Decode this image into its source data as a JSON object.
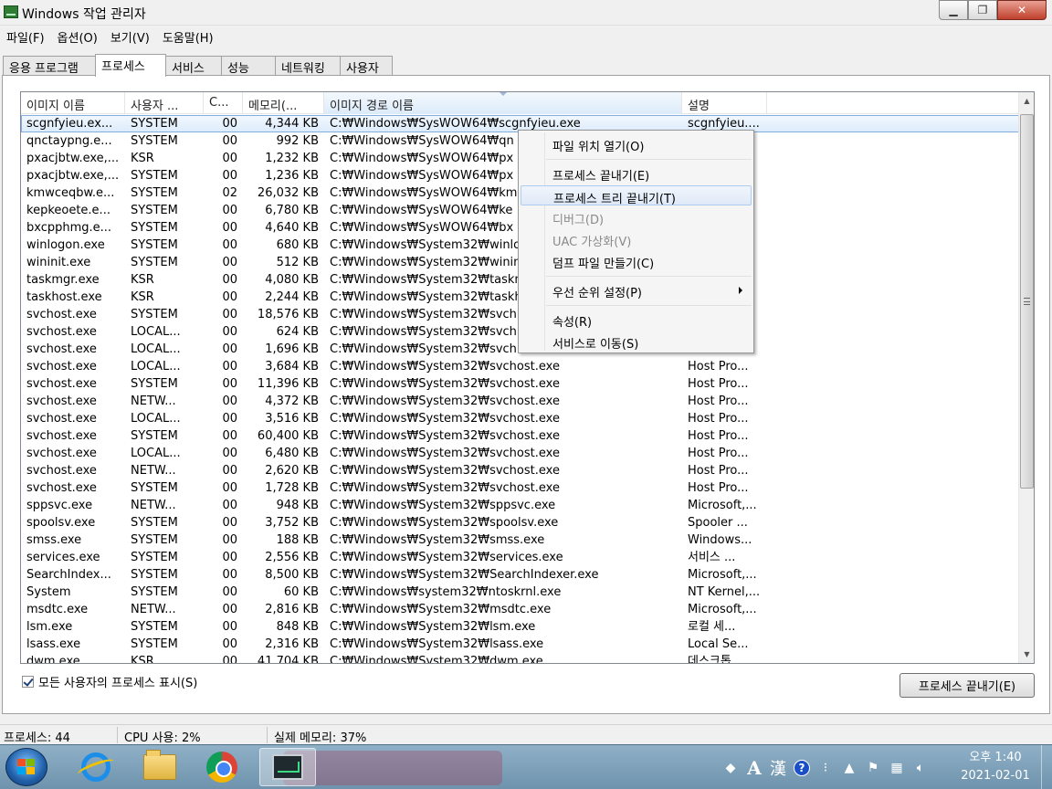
{
  "window": {
    "title": "Windows 작업 관리자"
  },
  "menu": [
    "파일(F)",
    "옵션(O)",
    "보기(V)",
    "도움말(H)"
  ],
  "tabs": [
    {
      "label": "응용 프로그램",
      "active": false
    },
    {
      "label": "프로세스",
      "active": true
    },
    {
      "label": "서비스",
      "active": false
    },
    {
      "label": "성능",
      "active": false
    },
    {
      "label": "네트워킹",
      "active": false
    },
    {
      "label": "사용자",
      "active": false
    }
  ],
  "columns": [
    "이미지 이름",
    "사용자 ...",
    "C...",
    "메모리(...",
    "이미지 경로 이름",
    "설명"
  ],
  "sorted_column": 4,
  "rows": [
    [
      "scgnfyieu.ex...",
      "SYSTEM",
      "00",
      "4,344 KB",
      "C:₩Windows₩SysWOW64₩scgnfyieu.exe",
      "scgnfyieu...."
    ],
    [
      "qnctaypng.e...",
      "SYSTEM",
      "00",
      "992 KB",
      "C:₩Windows₩SysWOW64₩qn",
      ""
    ],
    [
      "pxacjbtw.exe,...",
      "KSR",
      "00",
      "1,232 KB",
      "C:₩Windows₩SysWOW64₩px",
      ""
    ],
    [
      "pxacjbtw.exe,...",
      "SYSTEM",
      "00",
      "1,236 KB",
      "C:₩Windows₩SysWOW64₩px",
      ""
    ],
    [
      "kmwceqbw.e...",
      "SYSTEM",
      "02",
      "26,032 KB",
      "C:₩Windows₩SysWOW64₩km",
      ""
    ],
    [
      "kepkeoete.e...",
      "SYSTEM",
      "00",
      "6,780 KB",
      "C:₩Windows₩SysWOW64₩ke",
      ""
    ],
    [
      "bxcpphmg.e...",
      "SYSTEM",
      "00",
      "4,640 KB",
      "C:₩Windows₩SysWOW64₩bx",
      ""
    ],
    [
      "winlogon.exe",
      "SYSTEM",
      "00",
      "680 KB",
      "C:₩Windows₩System32₩winlo",
      ""
    ],
    [
      "wininit.exe",
      "SYSTEM",
      "00",
      "512 KB",
      "C:₩Windows₩System32₩winin",
      ""
    ],
    [
      "taskmgr.exe",
      "KSR",
      "00",
      "4,080 KB",
      "C:₩Windows₩System32₩taskn",
      ""
    ],
    [
      "taskhost.exe",
      "KSR",
      "00",
      "2,244 KB",
      "C:₩Windows₩System32₩taskh",
      ""
    ],
    [
      "svchost.exe",
      "SYSTEM",
      "00",
      "18,576 KB",
      "C:₩Windows₩System32₩svch",
      ""
    ],
    [
      "svchost.exe",
      "LOCAL...",
      "00",
      "624 KB",
      "C:₩Windows₩System32₩svch",
      ""
    ],
    [
      "svchost.exe",
      "LOCAL...",
      "00",
      "1,696 KB",
      "C:₩Windows₩System32₩svch",
      ""
    ],
    [
      "svchost.exe",
      "LOCAL...",
      "00",
      "3,684 KB",
      "C:₩Windows₩System32₩svchost.exe",
      "Host Pro..."
    ],
    [
      "svchost.exe",
      "SYSTEM",
      "00",
      "11,396 KB",
      "C:₩Windows₩System32₩svchost.exe",
      "Host Pro..."
    ],
    [
      "svchost.exe",
      "NETW...",
      "00",
      "4,372 KB",
      "C:₩Windows₩System32₩svchost.exe",
      "Host Pro..."
    ],
    [
      "svchost.exe",
      "LOCAL...",
      "00",
      "3,516 KB",
      "C:₩Windows₩System32₩svchost.exe",
      "Host Pro..."
    ],
    [
      "svchost.exe",
      "SYSTEM",
      "00",
      "60,400 KB",
      "C:₩Windows₩System32₩svchost.exe",
      "Host Pro..."
    ],
    [
      "svchost.exe",
      "LOCAL...",
      "00",
      "6,480 KB",
      "C:₩Windows₩System32₩svchost.exe",
      "Host Pro..."
    ],
    [
      "svchost.exe",
      "NETW...",
      "00",
      "2,620 KB",
      "C:₩Windows₩System32₩svchost.exe",
      "Host Pro..."
    ],
    [
      "svchost.exe",
      "SYSTEM",
      "00",
      "1,728 KB",
      "C:₩Windows₩System32₩svchost.exe",
      "Host Pro..."
    ],
    [
      "sppsvc.exe",
      "NETW...",
      "00",
      "948 KB",
      "C:₩Windows₩System32₩sppsvc.exe",
      "Microsoft,..."
    ],
    [
      "spoolsv.exe",
      "SYSTEM",
      "00",
      "3,752 KB",
      "C:₩Windows₩System32₩spoolsv.exe",
      "Spooler ..."
    ],
    [
      "smss.exe",
      "SYSTEM",
      "00",
      "188 KB",
      "C:₩Windows₩System32₩smss.exe",
      "Windows..."
    ],
    [
      "services.exe",
      "SYSTEM",
      "00",
      "2,556 KB",
      "C:₩Windows₩System32₩services.exe",
      "서비스 ..."
    ],
    [
      "SearchIndex...",
      "SYSTEM",
      "00",
      "8,500 KB",
      "C:₩Windows₩System32₩SearchIndexer.exe",
      "Microsoft,..."
    ],
    [
      "System",
      "SYSTEM",
      "00",
      "60 KB",
      "C:₩Windows₩system32₩ntoskrnl.exe",
      "NT Kernel,..."
    ],
    [
      "msdtc.exe",
      "NETW...",
      "00",
      "2,816 KB",
      "C:₩Windows₩System32₩msdtc.exe",
      "Microsoft,..."
    ],
    [
      "lsm.exe",
      "SYSTEM",
      "00",
      "848 KB",
      "C:₩Windows₩System32₩lsm.exe",
      "로컬 세..."
    ],
    [
      "lsass.exe",
      "SYSTEM",
      "00",
      "2,316 KB",
      "C:₩Windows₩System32₩lsass.exe",
      "Local Se..."
    ],
    [
      "dwm.exe",
      "KSR",
      "00",
      "41,704 KB",
      "C:₩Windows₩System32₩dwm.exe",
      "데스크톱..."
    ]
  ],
  "selected_row": 0,
  "context_menu": [
    {
      "label": "파일 위치 열기(O)",
      "disabled": false
    },
    {
      "sep": true
    },
    {
      "label": "프로세스 끝내기(E)",
      "disabled": false
    },
    {
      "label": "프로세스 트리 끝내기(T)",
      "disabled": false,
      "highlight": true
    },
    {
      "label": "디버그(D)",
      "disabled": true
    },
    {
      "label": "UAC 가상화(V)",
      "disabled": true
    },
    {
      "label": "덤프 파일 만들기(C)",
      "disabled": false
    },
    {
      "sep": true
    },
    {
      "label": "우선 순위 설정(P)",
      "disabled": false,
      "submenu": true
    },
    {
      "sep": true
    },
    {
      "label": "속성(R)",
      "disabled": false
    },
    {
      "label": "서비스로 이동(S)",
      "disabled": false
    }
  ],
  "show_all_label": "모든 사용자의 프로세스 표시(S)",
  "end_button_label": "프로세스 끝내기(E)",
  "status": {
    "processes": "프로세스: 44",
    "cpu": "CPU 사용: 2%",
    "memory": "실제 메모리: 37%"
  },
  "clock": {
    "time": "오후 1:40",
    "date": "2021-02-01"
  },
  "tray": {
    "ime_a": "A",
    "ime_han": "漢"
  }
}
